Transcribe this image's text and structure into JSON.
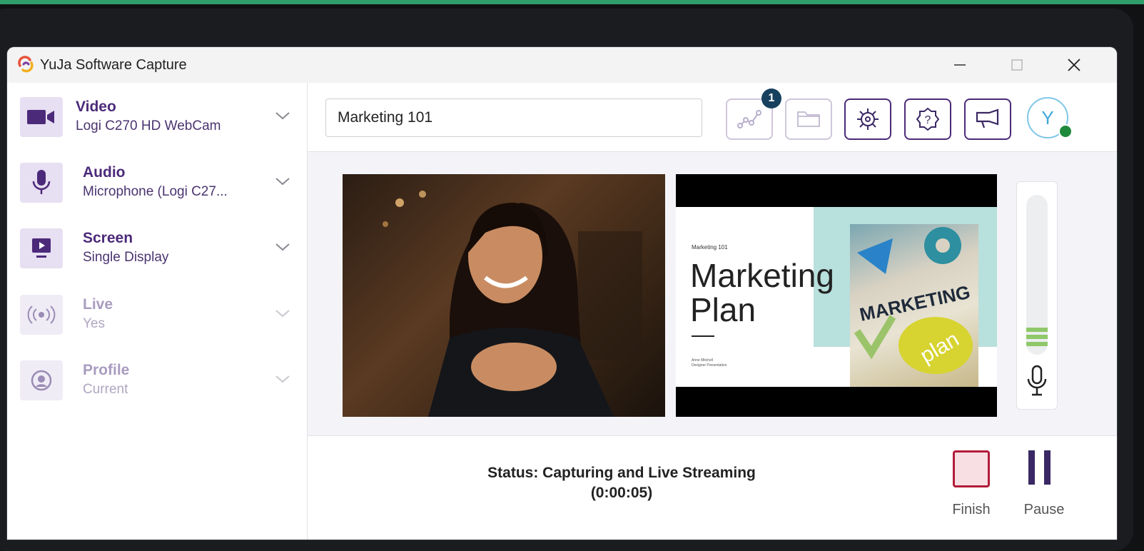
{
  "window": {
    "title": "YuJa Software Capture"
  },
  "sources": [
    {
      "name": "Video",
      "detail": "Logi C270 HD WebCam",
      "icon": "video-camera-icon",
      "enabled": true
    },
    {
      "name": "Audio",
      "detail": "Microphone (Logi C27...",
      "icon": "microphone-icon",
      "enabled": true
    },
    {
      "name": "Screen",
      "detail": "Single Display",
      "icon": "screen-share-icon",
      "enabled": true
    },
    {
      "name": "Live",
      "detail": "Yes",
      "icon": "live-broadcast-icon",
      "enabled": false
    },
    {
      "name": "Profile",
      "detail": "Current",
      "icon": "profile-icon",
      "enabled": false
    }
  ],
  "toolbar": {
    "title_value": "Marketing 101",
    "analytics_badge": "1",
    "avatar_initial": "Y"
  },
  "slide": {
    "small_title": "Marketing 101",
    "headline_line1": "Marketing",
    "headline_line2": "Plan",
    "author": "Anne Mitchell",
    "author_role": "Designer Presentation"
  },
  "status": {
    "line1": "Status: Capturing and Live Streaming",
    "line2": "(0:00:05)"
  },
  "controls": {
    "finish_label": "Finish",
    "pause_label": "Pause"
  },
  "audio_level": 0.14,
  "colors": {
    "accent": "#4c2a7a",
    "finish": "#b11c3a",
    "level": "#8fc86a",
    "presence": "#1f8a3c"
  }
}
